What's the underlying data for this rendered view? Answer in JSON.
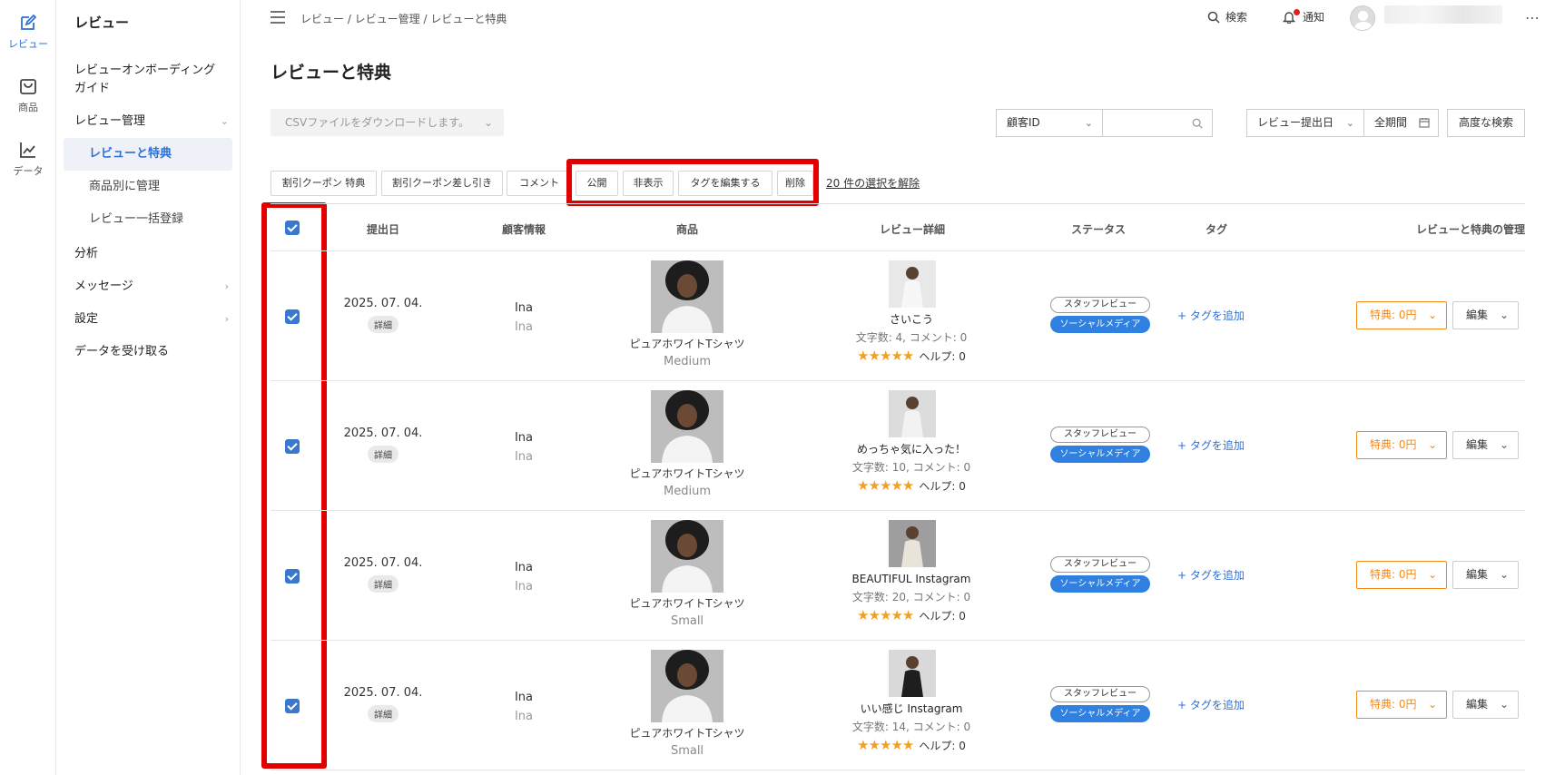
{
  "rail": {
    "items": [
      {
        "label": "レビュー",
        "icon": "edit-icon",
        "active": true
      },
      {
        "label": "商品",
        "icon": "bag-icon",
        "active": false
      },
      {
        "label": "データ",
        "icon": "chart-icon",
        "active": false
      }
    ]
  },
  "sidebar": {
    "title": "レビュー",
    "onboarding_line1": "レビューオンボーディング",
    "onboarding_line2": "ガイド",
    "review_mgmt": "レビュー管理",
    "sub_reviews": "レビューと特典",
    "sub_by_product": "商品別に管理",
    "sub_bulk": "レビュー一括登録",
    "analysis": "分析",
    "messages": "メッセージ",
    "settings": "設定",
    "receive_data": "データを受け取る"
  },
  "topbar": {
    "breadcrumb": "レビュー / レビュー管理 / レビューと特典",
    "search": "検索",
    "notice": "通知"
  },
  "page": {
    "title": "レビューと特典"
  },
  "filters": {
    "csv_placeholder": "CSVファイルをダウンロードします。",
    "customer_id": "顧客ID",
    "review_date": "レビュー提出日",
    "period": "全期間",
    "advanced": "高度な検索"
  },
  "actions": {
    "coupon_benefit": "割引クーポン 特典",
    "coupon_deduct": "割引クーポン差し引き",
    "comment": "コメント",
    "publish": "公開",
    "hide": "非表示",
    "edit_tags": "タグを編集する",
    "delete": "削除",
    "deselect": "20 件の選択を解除"
  },
  "table": {
    "headers": {
      "date": "提出日",
      "customer": "顧客情報",
      "product": "商品",
      "review": "レビュー詳細",
      "status": "ステータス",
      "tag": "タグ",
      "manage": "レビューと特典の管理"
    },
    "rows": [
      {
        "date": "2025. 07. 04.",
        "detail": "詳細",
        "name": "Ina",
        "name_sub": "Ina",
        "product": "ピュアホワイトTシャツ",
        "size": "Medium",
        "review_title": "さいこう",
        "review_meta": "文字数: 4, コメント: 0",
        "stars": "★★★★★",
        "helpful": "ヘルプ: 0",
        "staff": "スタッフレビュー",
        "social": "ソーシャルメディア",
        "add_tag": "+ タグを追加",
        "benefit": "特典: 0円",
        "edit": "編集"
      },
      {
        "date": "2025. 07. 04.",
        "detail": "詳細",
        "name": "Ina",
        "name_sub": "Ina",
        "product": "ピュアホワイトTシャツ",
        "size": "Medium",
        "review_title": "めっちゃ気に入った！",
        "review_meta": "文字数: 10, コメント: 0",
        "stars": "★★★★★",
        "helpful": "ヘルプ: 0",
        "staff": "スタッフレビュー",
        "social": "ソーシャルメディア",
        "add_tag": "+ タグを追加",
        "benefit": "特典: 0円",
        "edit": "編集"
      },
      {
        "date": "2025. 07. 04.",
        "detail": "詳細",
        "name": "Ina",
        "name_sub": "Ina",
        "product": "ピュアホワイトTシャツ",
        "size": "Small",
        "review_title": "BEAUTIFUL Instagram",
        "review_meta": "文字数: 20, コメント: 0",
        "stars": "★★★★★",
        "helpful": "ヘルプ: 0",
        "staff": "スタッフレビュー",
        "social": "ソーシャルメディア",
        "add_tag": "+ タグを追加",
        "benefit": "特典: 0円",
        "edit": "編集"
      },
      {
        "date": "2025. 07. 04.",
        "detail": "詳細",
        "name": "Ina",
        "name_sub": "Ina",
        "product": "ピュアホワイトTシャツ",
        "size": "Small",
        "review_title": "いい感じ Instagram",
        "review_meta": "文字数: 14, コメント: 0",
        "stars": "★★★★★",
        "helpful": "ヘルプ: 0",
        "staff": "スタッフレビュー",
        "social": "ソーシャルメディア",
        "add_tag": "+ タグを追加",
        "benefit": "特典: 0円",
        "edit": "編集"
      }
    ]
  },
  "colors": {
    "accent": "#2f6fd6",
    "highlight": "#e00000",
    "benefit": "#f08a1c",
    "social": "#2f80e0"
  }
}
